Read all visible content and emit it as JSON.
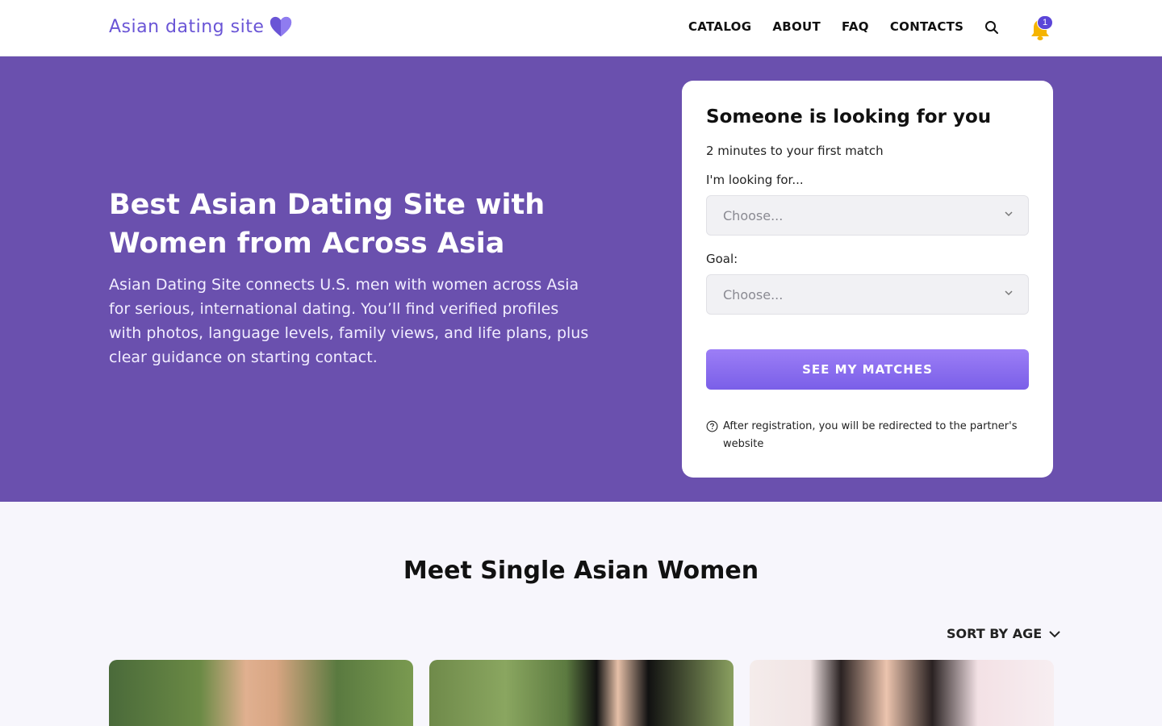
{
  "header": {
    "logo_text": "Asian dating site",
    "nav": [
      "CATALOG",
      "ABOUT",
      "FAQ",
      "CONTACTS"
    ],
    "notification_count": "1",
    "icons": [
      "search-icon",
      "bell-icon",
      "heart-logo-icon"
    ]
  },
  "hero": {
    "title": "Best Asian Dating Site with Women from Across Asia",
    "description": "Asian Dating Site connects U.S. men with women across Asia for serious, international dating. You’ll find verified profiles with photos, language levels, family views, and life plans, plus clear guidance on starting contact."
  },
  "match_card": {
    "title": "Someone is looking for you",
    "subtitle": "2 minutes to your first match",
    "looking_for_label": "I'm looking for...",
    "looking_for_value": "Choose...",
    "goal_label": "Goal:",
    "goal_value": "Choose...",
    "cta_label": "SEE MY MATCHES",
    "note": "After registration, you will be redirected to the partner's website"
  },
  "catalog": {
    "title": "Meet Single Asian Women",
    "sort_label": "SORT BY AGE"
  },
  "colors": {
    "hero_bg": "#6a50ae",
    "accent": "#7a5fe8",
    "logo": "#6a55d6",
    "badge": "#5b45d8",
    "bell": "#f5b400"
  }
}
